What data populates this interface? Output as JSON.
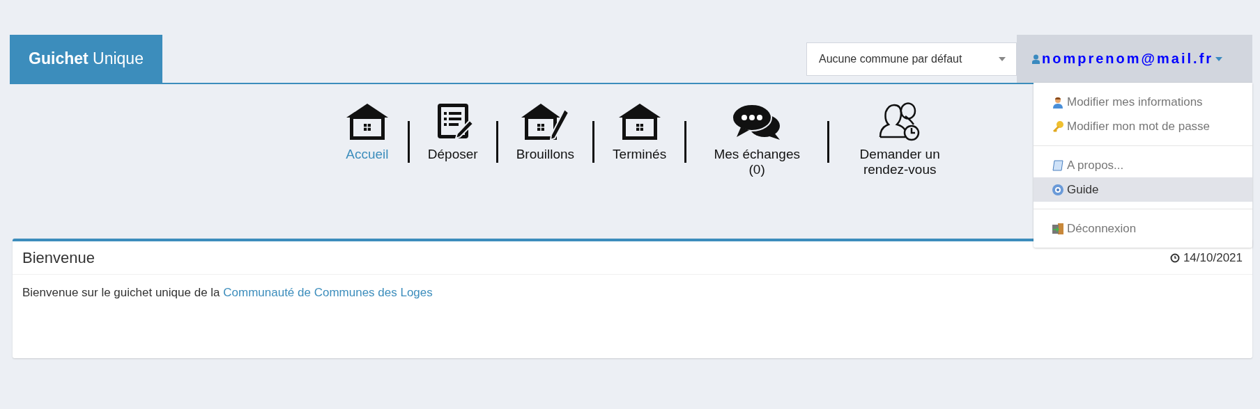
{
  "brand": {
    "bold": "Guichet",
    "rest": "Unique"
  },
  "commune_select": {
    "value": "Aucune commune par défaut"
  },
  "user_menu": {
    "label": "nomprenom@mail.fr",
    "expanded": true,
    "items": [
      {
        "kind": "item",
        "label": "Modifier mes informations",
        "selected": false
      },
      {
        "kind": "item",
        "label": "Modifier mon mot de passe",
        "selected": false
      },
      {
        "kind": "divider"
      },
      {
        "kind": "item",
        "label": "A propos...",
        "selected": false
      },
      {
        "kind": "item",
        "label": "Guide",
        "selected": true
      },
      {
        "kind": "divider"
      },
      {
        "kind": "item",
        "label": "Déconnexion",
        "selected": false
      }
    ]
  },
  "nav": [
    {
      "label": "Accueil",
      "selected": true
    },
    {
      "label": "Déposer",
      "selected": false
    },
    {
      "label": "Brouillons",
      "selected": false
    },
    {
      "label": "Terminés",
      "selected": false
    },
    {
      "label": "Mes échanges (0)",
      "selected": false
    },
    {
      "label": "Demander un rendez-vous",
      "selected": false
    }
  ],
  "card": {
    "title": "Bienvenue",
    "date": "14/10/2021",
    "text": "Bienvenue sur le guichet unique de la",
    "link": "Communauté de Communes des Loges"
  }
}
